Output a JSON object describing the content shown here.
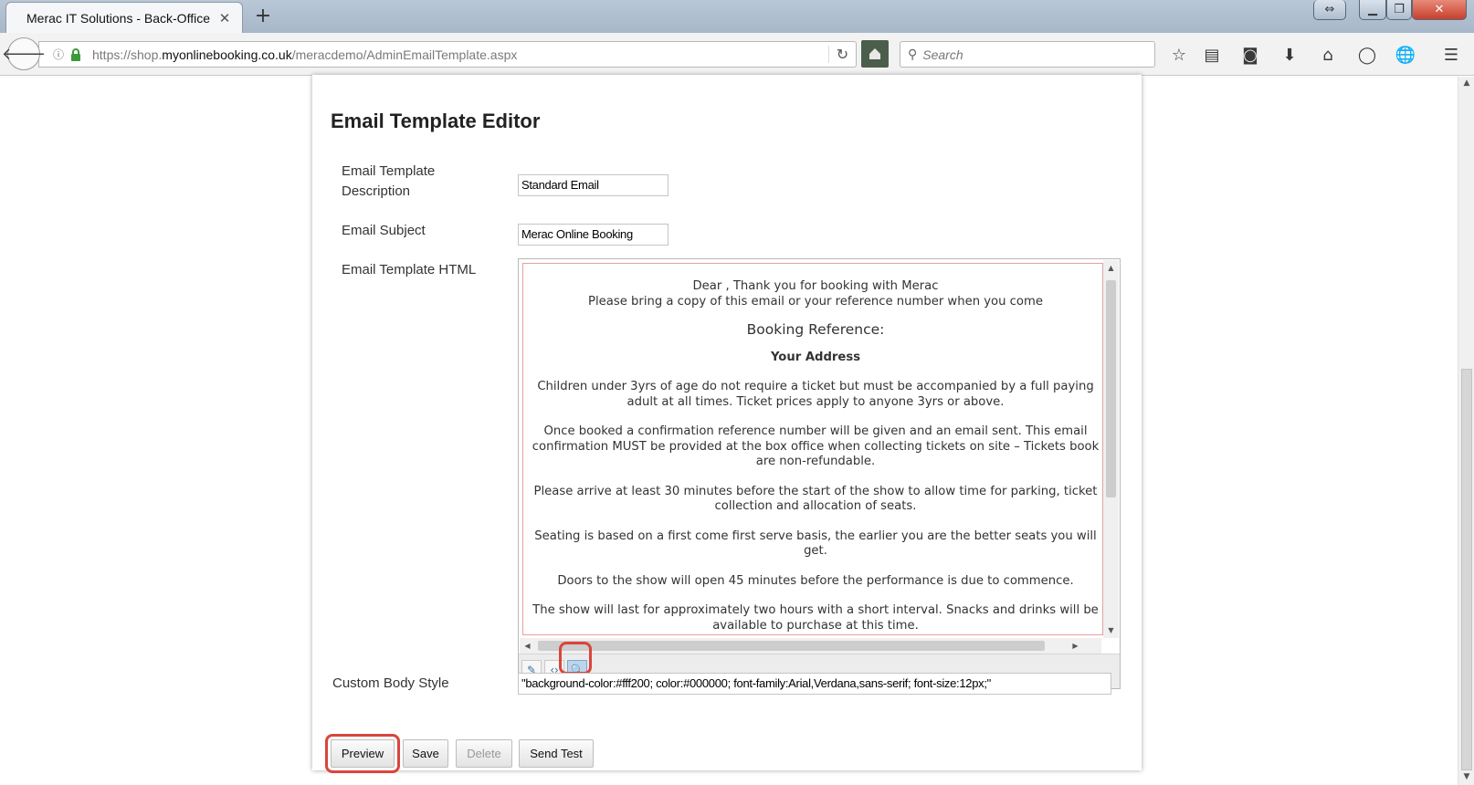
{
  "browser": {
    "tab_title": "Merac IT Solutions - Back-Office",
    "tab_close": "✕",
    "new_tab": "+",
    "url_prefix": "https://shop.",
    "url_host": "myonlinebooking.co.uk",
    "url_path": "/meracdemo/AdminEmailTemplate.aspx",
    "search_placeholder": "Search"
  },
  "page": {
    "title": "Email Template Editor"
  },
  "form": {
    "description_label_line1": "Email Template",
    "description_label_line2": "Description",
    "description_value": "Standard Email",
    "subject_label": "Email Subject",
    "subject_value": "Merac Online Booking",
    "html_label": "Email Template HTML",
    "custom_body_style_label": "Custom Body Style",
    "custom_body_style_value": "\"background-color:#fff200; color:#000000; font-family:Arial,Verdana,sans-serif; font-size:12px;\""
  },
  "email_preview": {
    "line_dear": "Dear , Thank you for booking with Merac",
    "line_bring": "Please bring a copy of this email or your reference number when you come",
    "booking_reference": "Booking Reference:",
    "your_address": "Your Address",
    "p_children": "Children under 3yrs of age do not require a ticket but must be accompanied by a full paying adult at all times. Ticket prices apply to anyone 3yrs or above.",
    "p_booked": "Once booked a confirmation reference number will be given and an email sent. This email confirmation MUST be provided at the box office when collecting tickets on site – Tickets book are non-refundable.",
    "p_arrive": "Please arrive at least 30 minutes before the start of the show to allow time for parking, ticket collection and allocation of seats.",
    "p_seating": "Seating is based on a first come first serve basis, the earlier you are the better seats you will get.",
    "p_doors": "Doors to the show will open 45 minutes before the performance is due to commence.",
    "p_show": "The show will last for approximately two hours with a short interval. Snacks and drinks will be available to purchase at this time."
  },
  "editor_modes": {
    "design_icon": "pencil-icon",
    "html_icon": "code-icon",
    "preview_icon": "magnifier-icon",
    "active": "preview"
  },
  "buttons": {
    "preview": "Preview",
    "save": "Save",
    "delete": "Delete",
    "send_test": "Send Test"
  },
  "colors": {
    "callout": "#d9453c",
    "lock_green": "#3c9a3c"
  }
}
